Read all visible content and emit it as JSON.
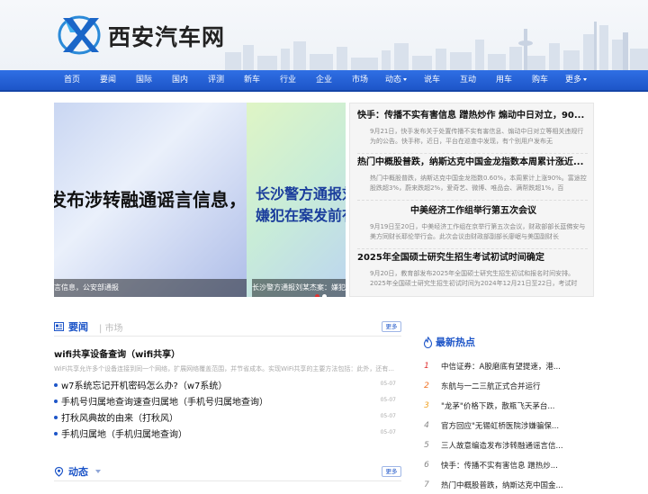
{
  "site": {
    "name": "西安汽车网"
  },
  "nav": [
    {
      "label": "首页"
    },
    {
      "label": "要闻"
    },
    {
      "label": "国际"
    },
    {
      "label": "国内"
    },
    {
      "label": "评测"
    },
    {
      "label": "新车"
    },
    {
      "label": "行业"
    },
    {
      "label": "企业"
    },
    {
      "label": "市场"
    },
    {
      "label": "动态",
      "dropdown": true
    },
    {
      "label": "说车"
    },
    {
      "label": "互动"
    },
    {
      "label": "用车"
    },
    {
      "label": "购车"
    },
    {
      "label": "更多",
      "dropdown": true
    }
  ],
  "banner": {
    "slide1_text": "发布涉转融通谣言信息，公安部",
    "slide2_line1": "长沙警方通报刘某杰",
    "slide2_line2": "嫌犯在案发前有交",
    "caption1": "言信息，公安部通报",
    "caption2": "长沙警方通报刘某杰案：嫌犯"
  },
  "headlines": [
    {
      "title": "快手：传播不实有害信息 蹭热炒作 煽动中日对立，90...",
      "desc": "9月21日，快手发布关于处置传播不实有害信息、煽动中日对立等相关违规行为的公告。快手称，近日，平台在巡查中发现，有个别用户发布无"
    },
    {
      "title": "热门中概股普跌，纳斯达克中国金龙指数本周累计涨近...",
      "desc": "热门中概股普跌，纳斯达克中国金龙指数0.60%，本周累计上涨90%。富途控股跌超3%，蔚来跌超2%，爱奇艺、微博、唯品会、满帮跌超1%，百"
    },
    {
      "title": "中美经济工作组举行第五次会议",
      "desc": "9月19日至20日，中美经济工作组在京举行第五次会议，财政部部长蓝佛安与美方同财长耶伦举行会。此次会议由财政部副部长廖岷与美国副财长"
    },
    {
      "title": "2025年全国硕士研究生招生考试初试时间确定",
      "desc": "9月20日，教育部发布2025年全国硕士研究生招生初试和报名时间安排。2025年全国硕士研究生招生初试时间为2024年12月21日至22日，考试时"
    }
  ],
  "section1": {
    "title": "要闻",
    "sub": "市场",
    "more": "更多"
  },
  "featured": {
    "title": "wifi共享设备查询（wifi共享）",
    "desc": "WiFi共享允许多个设备连接到同一个网络，扩展网络覆盖范围，并节省成本。实现WiFi共享的主要方法包括：此外，还有..."
  },
  "list": [
    {
      "title": "w7系统忘记开机密码怎么办?（w7系统）",
      "date": "05-07"
    },
    {
      "title": "手机号归属地查询速查归属地（手机号归属地查询）",
      "date": "05-07"
    },
    {
      "title": "打秋风典故的由来（打秋风）",
      "date": "05-07"
    },
    {
      "title": "手机归属地（手机归属地查询）",
      "date": "05-07"
    }
  ],
  "section2": {
    "title": "动态",
    "more": "更多"
  },
  "hot": {
    "title": "最新热点",
    "items": [
      {
        "num": "1",
        "text": "中信证券：A股磨底有望提速，港..."
      },
      {
        "num": "2",
        "text": "东航与一二三航正式合并运行"
      },
      {
        "num": "3",
        "text": "\"龙茅\"价格下跌，散瓶飞天茅台..."
      },
      {
        "num": "4",
        "text": "官方回应\"无锡虹桥医院涉嫌骗保..."
      },
      {
        "num": "5",
        "text": "三人故意编造发布涉转融通谣言信..."
      },
      {
        "num": "6",
        "text": "快手：传播不实有害信息 蹭热炒..."
      },
      {
        "num": "7",
        "text": "热门中概股普跌，纳斯达克中国金..."
      }
    ]
  },
  "colors": {
    "nav": "#1d55c8",
    "rank1": "#e03030",
    "rank2": "#f07020",
    "rank3": "#f0a020",
    "rank_other": "#888888"
  }
}
